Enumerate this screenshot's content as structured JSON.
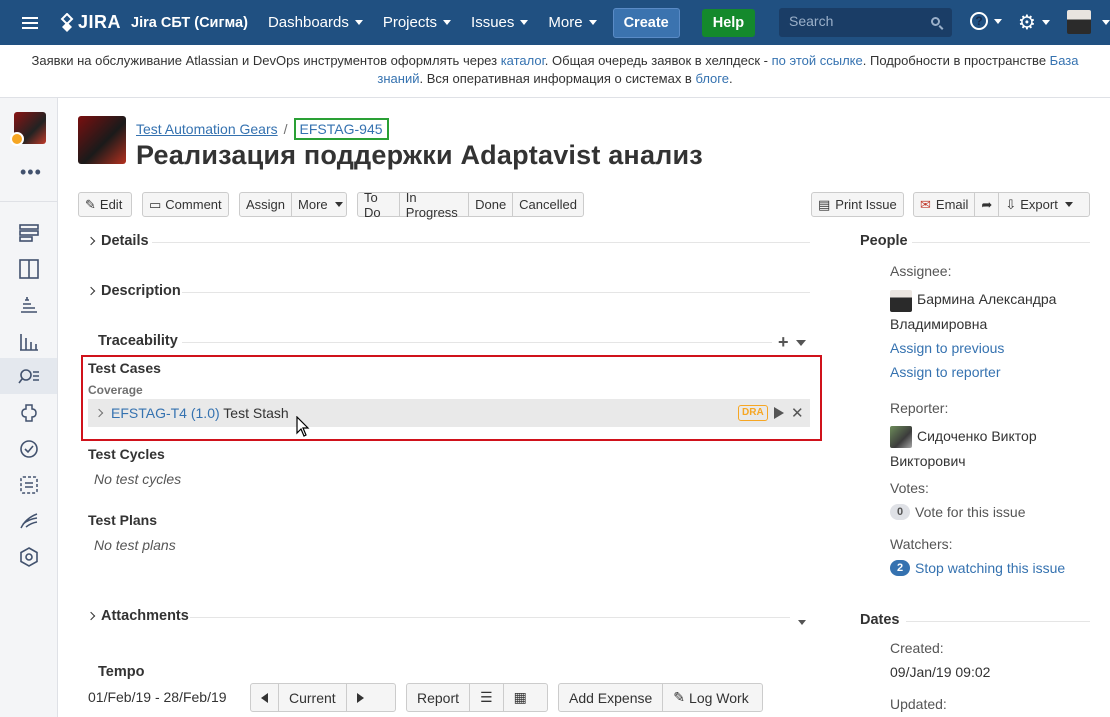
{
  "nav": {
    "logo": "JIRA",
    "app_name": "Jira СБТ (Сигма)",
    "items": [
      "Dashboards",
      "Projects",
      "Issues",
      "More"
    ],
    "create": "Create",
    "help": "Help",
    "search_placeholder": "Search"
  },
  "banner": {
    "t1": "Заявки на обслуживание Atlassian и DevOps инструментов оформлять через ",
    "l1": "каталог",
    "t2": ". Общая очередь заявок в хелпдеск - ",
    "l2": "по этой ссылке",
    "t3": ". Подробности в пространстве ",
    "l3": "База знаний",
    "t4": ". Вся оперативная информация о системах в ",
    "l4": "блоге",
    "t5": "."
  },
  "issue": {
    "project": "Test Automation Gears",
    "separator": "/",
    "key": "EFSTAG-945",
    "title": "Реализация поддержки Adaptavist анализ"
  },
  "toolbar": {
    "edit": "Edit",
    "comment": "Comment",
    "assign": "Assign",
    "more": "More",
    "todo": "To Do",
    "in_progress": "In Progress",
    "done": "Done",
    "cancelled": "Cancelled",
    "print": "Print Issue",
    "email": "Email",
    "export": "Export"
  },
  "modules": {
    "details": "Details",
    "description": "Description",
    "traceability": "Traceability",
    "test_cases": "Test Cases",
    "coverage": "Coverage",
    "test_case_key": "EFSTAG-T4 (1.0)",
    "test_case_name": "Test Stash",
    "draft": "DRA",
    "test_cycles": "Test Cycles",
    "no_cycles": "No test cycles",
    "test_plans": "Test Plans",
    "no_plans": "No test plans",
    "attachments": "Attachments",
    "tempo": "Tempo"
  },
  "tempo": {
    "range": "01/Feb/19 - 28/Feb/19",
    "current": "Current",
    "report": "Report",
    "add_expense": "Add Expense",
    "log_work": "Log Work"
  },
  "people": {
    "heading": "People",
    "assignee_label": "Assignee:",
    "assignee_line1": "Бармина Александра",
    "assignee_line2": "Владимировна",
    "assign_previous": "Assign to previous",
    "assign_reporter": "Assign to reporter",
    "reporter_label": "Reporter:",
    "reporter_line1": "Сидоченко Виктор",
    "reporter_line2": "Викторович",
    "votes_label": "Votes:",
    "votes_count": "0",
    "vote_text": "Vote for this issue",
    "watchers_label": "Watchers:",
    "watchers_count": "2",
    "watch_text": "Stop watching this issue"
  },
  "dates": {
    "heading": "Dates",
    "created_label": "Created:",
    "created": "09/Jan/19 09:02",
    "updated_label": "Updated:"
  }
}
